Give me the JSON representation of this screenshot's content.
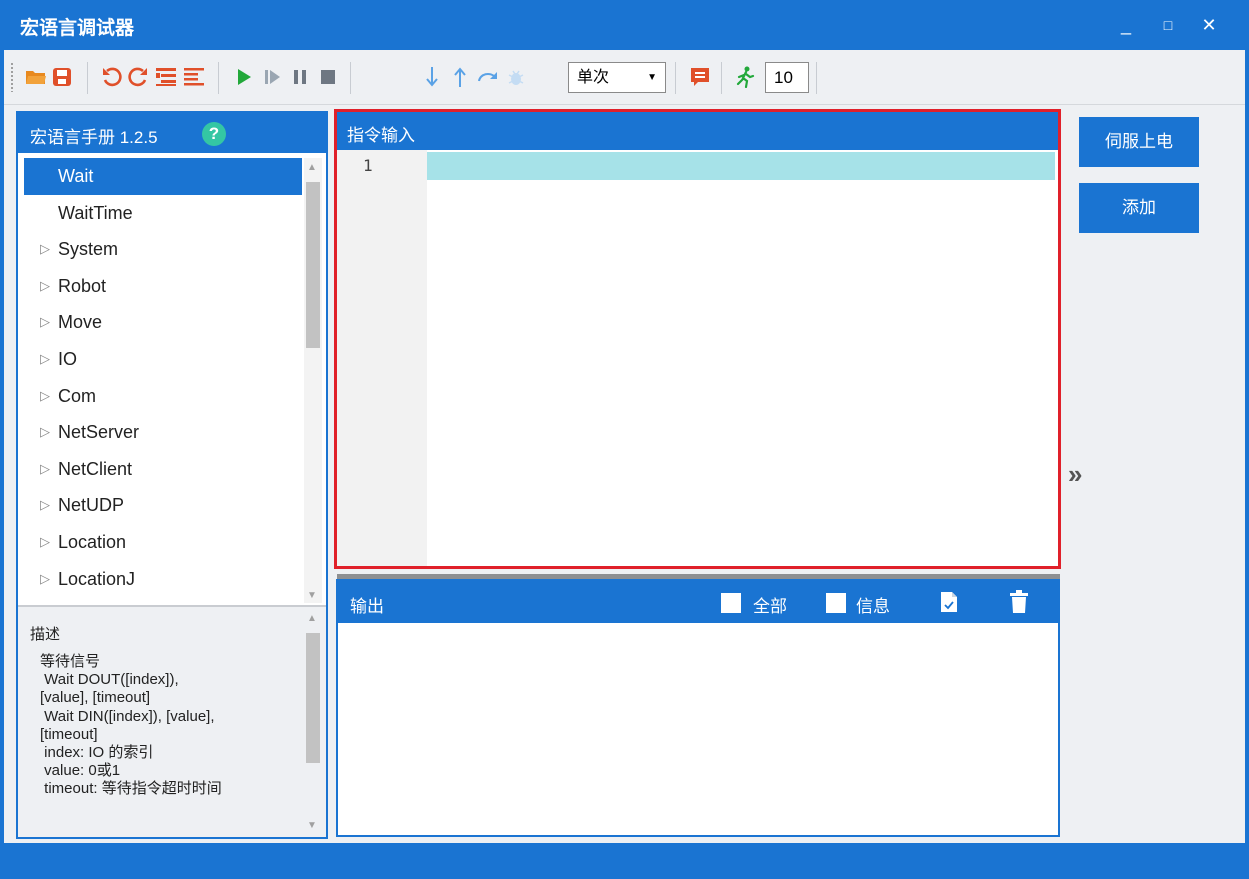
{
  "window": {
    "title": "宏语言调试器",
    "minimize": "_",
    "maximize": "□",
    "close": "✕"
  },
  "toolbar": {
    "run_mode": "单次",
    "count": "10",
    "icons": [
      "open-folder-icon",
      "save-icon",
      "undo-icon",
      "redo-icon",
      "indent-icon",
      "outdent-icon",
      "run-icon",
      "step-run-icon",
      "pause-icon",
      "stop-icon",
      "step-into-icon",
      "step-out-icon",
      "step-over-icon",
      "debug-icon",
      "message-icon",
      "runner-icon"
    ]
  },
  "manual": {
    "title": "宏语言手册 1.2.5",
    "help": "?",
    "items": [
      {
        "label": "Wait",
        "expandable": false,
        "selected": true
      },
      {
        "label": "WaitTime",
        "expandable": false,
        "selected": false
      },
      {
        "label": "System",
        "expandable": true,
        "selected": false
      },
      {
        "label": "Robot",
        "expandable": true,
        "selected": false
      },
      {
        "label": "Move",
        "expandable": true,
        "selected": false
      },
      {
        "label": "IO",
        "expandable": true,
        "selected": false
      },
      {
        "label": "Com",
        "expandable": true,
        "selected": false
      },
      {
        "label": "NetServer",
        "expandable": true,
        "selected": false
      },
      {
        "label": "NetClient",
        "expandable": true,
        "selected": false
      },
      {
        "label": "NetUDP",
        "expandable": true,
        "selected": false
      },
      {
        "label": "Location",
        "expandable": true,
        "selected": false
      },
      {
        "label": "LocationJ",
        "expandable": true,
        "selected": false
      }
    ],
    "expander_glyph": "▷"
  },
  "description": {
    "title": "描述",
    "text": "等待信号\n Wait DOUT([index]),\n[value], [timeout]\n Wait DIN([index]), [value],\n[timeout]\n index: IO 的索引\n value: 0或1\n timeout: 等待指令超时时间"
  },
  "editor": {
    "title": "指令输入",
    "line_numbers": [
      "1"
    ]
  },
  "output": {
    "title": "输出",
    "all_label": "全部",
    "info_label": "信息"
  },
  "actions": {
    "servo_on": "伺服上电",
    "add": "添加",
    "expand": "»"
  },
  "colors": {
    "accent": "#1a74d2",
    "editor_border": "#e0202a",
    "current_line": "#a6e2e8",
    "run_green": "#22a83a",
    "debug_blue": "#5aa2e6",
    "edit_red": "#e0502a",
    "folder_orange": "#e8891e"
  }
}
